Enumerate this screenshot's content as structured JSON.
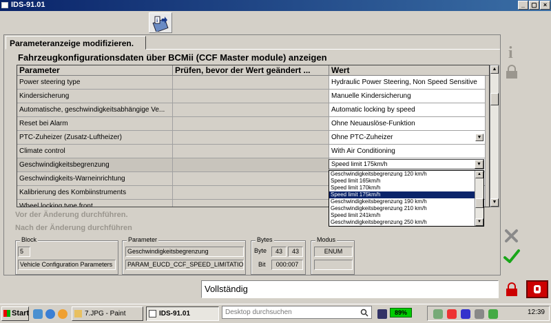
{
  "window": {
    "title": "IDS-91.01",
    "controls": [
      "_",
      "▢",
      "×"
    ]
  },
  "panel": {
    "tab_label": "Parameteranzeige modifizieren.",
    "section_title": "Fahrzeugkonfigurationsdaten über BCMii (CCF Master module) anzeigen"
  },
  "table": {
    "headers": [
      "Parameter",
      "Prüfen, bevor der Wert geändert ...",
      "Wert"
    ],
    "rows": [
      {
        "param": "Power steering type",
        "check": "",
        "value": "Hydraulic Power Steering, Non Speed Sensitive"
      },
      {
        "param": "Kindersicherung",
        "check": "",
        "value": "Manuelle Kindersicherung"
      },
      {
        "param": "Automatische, geschwindigkeitsabhängige Ve...",
        "check": "",
        "value": "Automatic locking by speed"
      },
      {
        "param": "Reset bei Alarm",
        "check": "",
        "value": "Ohne Neuauslöse-Funktion"
      },
      {
        "param": "PTC-Zuheizer (Zusatz-Luftheizer)",
        "check": "",
        "value": "Ohne PTC-Zuheizer"
      },
      {
        "param": "Climate control",
        "check": "",
        "value": "With Air Conditioning"
      },
      {
        "param": "Geschwindigkeitsbegrenzung",
        "check": "",
        "value": ""
      },
      {
        "param": "Geschwindigkeits-Warneinrichtung",
        "check": "",
        "value": ""
      },
      {
        "param": "Kalibrierung des Kombiinstruments",
        "check": "",
        "value": ""
      },
      {
        "param": "Wheel locking type front",
        "check": "",
        "value": ""
      }
    ]
  },
  "dropdown": {
    "selected": "Speed limit 175km/h",
    "options": [
      "Geschwindigkeitsbegrenzung 120 km/h",
      "Speed limit 165km/h",
      "Speed limit 170km/h",
      "Speed limit 175km/h",
      "Geschwindigkeitsbegrenzung 190 km/h",
      "Geschwindigkeitsbegrenzung 210 km/h",
      "Speed limit 241km/h",
      "Geschwindigkeitsbegrenzung 250 km/h"
    ]
  },
  "state_labels": {
    "before": "Vor der Änderung durchführen.",
    "after": "Nach der Änderung durchführen"
  },
  "groups": {
    "block": {
      "legend": "Block",
      "number": "5",
      "name": "Vehicle Configuration Parameters"
    },
    "parameter": {
      "legend": "Parameter",
      "name": "Geschwindigkeitsbegrenzung",
      "id": "PARAM_EUCD_CCF_SPEED_LIMITATION"
    },
    "bytes": {
      "legend": "Bytes",
      "byte_label": "Byte",
      "byte_a": "43",
      "byte_b": "43",
      "bit_label": "Bit",
      "bit": "000:007"
    },
    "modus": {
      "legend": "Modus",
      "value": "ENUM",
      "value2": ""
    }
  },
  "status": {
    "text": "Vollständig"
  },
  "taskbar": {
    "start": "Start",
    "tasks": [
      {
        "label": "7.JPG - Paint",
        "active": false
      },
      {
        "label": "IDS-91.01",
        "active": true
      }
    ],
    "search_placeholder": "Desktop durchsuchen",
    "battery": "89%",
    "clock": "12:39"
  },
  "colors": {
    "selection": "#0a246a",
    "accept": "#19a619",
    "cancel": "#8a8a8a",
    "stop": "#cc0000"
  }
}
